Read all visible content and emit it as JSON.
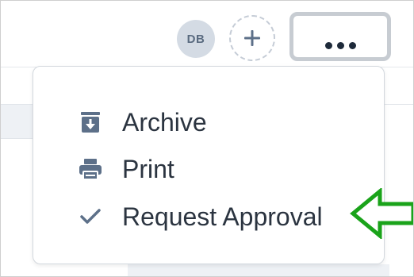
{
  "header": {
    "avatar_initials": "DB",
    "add_member_symbol": "+",
    "more_icon": "ellipsis-icon"
  },
  "menu": {
    "items": [
      {
        "label": "Archive",
        "icon": "archive-icon"
      },
      {
        "label": "Print",
        "icon": "printer-icon"
      },
      {
        "label": "Request Approval",
        "icon": "checkmark-icon"
      }
    ]
  },
  "annotation": {
    "arrow_color": "#1aa31a",
    "arrow_direction": "left"
  },
  "colors": {
    "icon": "#5d7089",
    "text": "#2b3440",
    "avatar_bg": "#d4dbe4"
  }
}
